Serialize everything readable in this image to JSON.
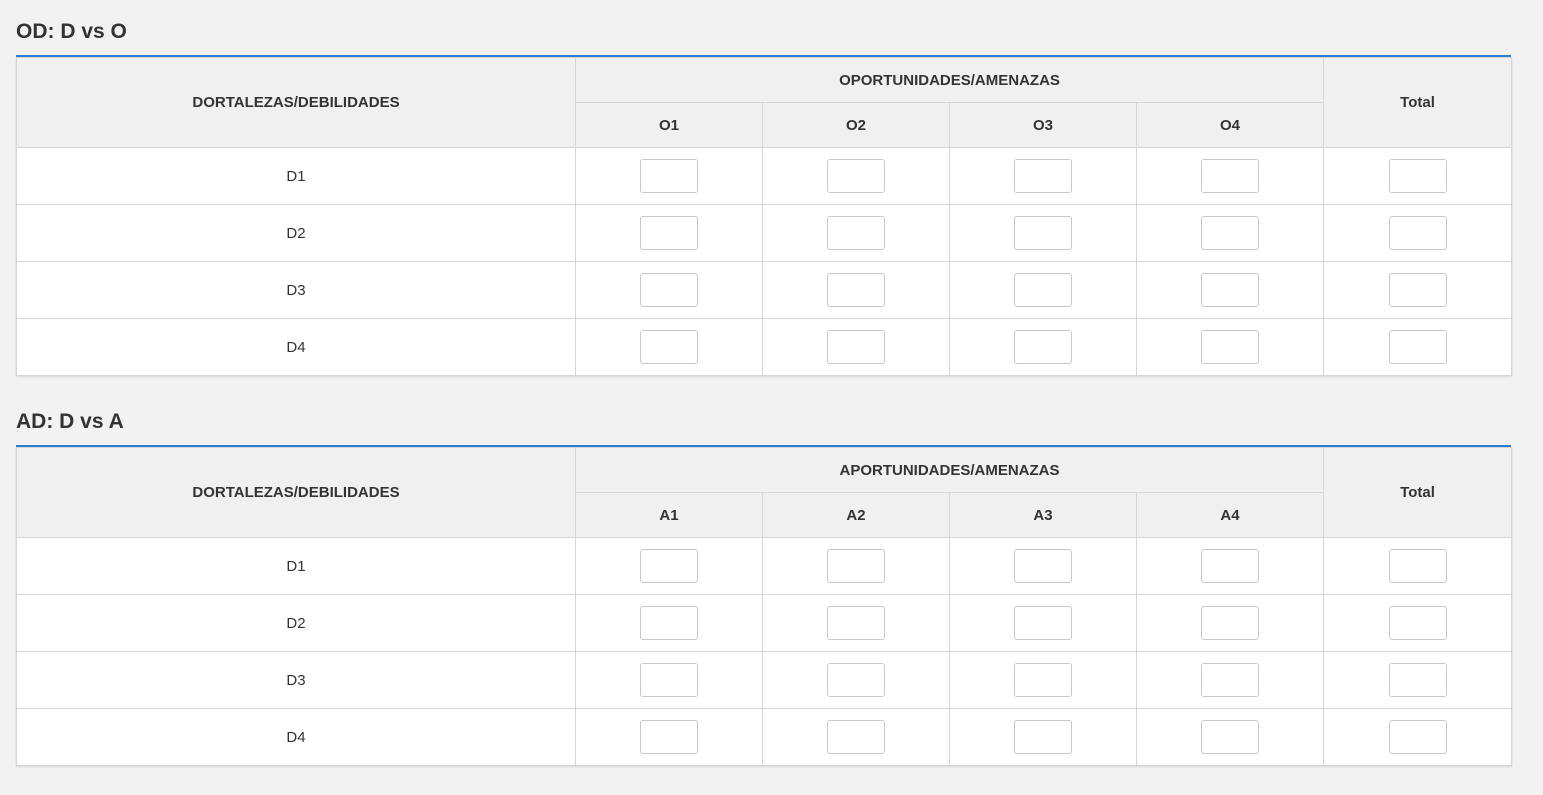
{
  "sections": [
    {
      "title": "OD: D vs O",
      "row_header": "DORTALEZAS/DEBILIDADES",
      "group_header": "OPORTUNIDADES/AMENAZAS",
      "total_header": "Total",
      "columns": [
        "O1",
        "O2",
        "O3",
        "O4"
      ],
      "rows": [
        "D1",
        "D2",
        "D3",
        "D4"
      ]
    },
    {
      "title": "AD: D vs A",
      "row_header": "DORTALEZAS/DEBILIDADES",
      "group_header": "APORTUNIDADES/AMENAZAS",
      "total_header": "Total",
      "columns": [
        "A1",
        "A2",
        "A3",
        "A4"
      ],
      "rows": [
        "D1",
        "D2",
        "D3",
        "D4"
      ]
    }
  ],
  "colors": {
    "accent_rule": "#2a7fd4",
    "page_background": "#f2f2f2",
    "header_background": "#f0f0f0"
  }
}
